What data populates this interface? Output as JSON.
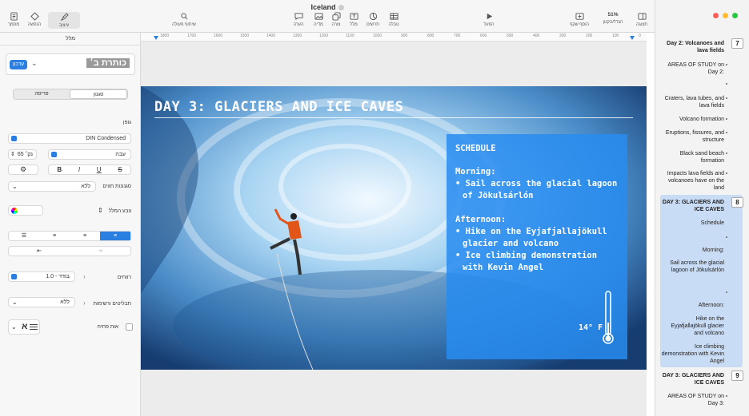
{
  "window": {
    "title": "Iceland"
  },
  "toolbar": {
    "view": "תצוגה",
    "zoom_value": "51%",
    "zoom": "הגדל/הקטן",
    "add_slide": "הוסף שקף",
    "play": "הפעל",
    "table": "טבלה",
    "chart": "תרשים",
    "text": "מלל",
    "shape": "צורה",
    "media": "מדיה",
    "comment": "הערה",
    "collaborate": "שיתוף פעולה",
    "format": "עיצוב",
    "animate": "הנפשה",
    "document": "מסמך"
  },
  "ruler": {
    "ticks": [
      "1800",
      "1700",
      "1600",
      "1500",
      "1400",
      "1300",
      "1200",
      "1100",
      "1000",
      "900",
      "800",
      "700",
      "600",
      "500",
      "400",
      "300",
      "200",
      "100",
      "0"
    ]
  },
  "inspector": {
    "header": "מלל",
    "style_name": "כותרת ב׳",
    "update_button": "עדכון",
    "tabs": [
      "פריסה",
      "סגנון"
    ],
    "font_section": "גופן",
    "font_name": "DIN Condensed",
    "font_weight": "עבה",
    "font_size": "65 נק׳",
    "char_styles_label": "סגנונות תווים",
    "char_styles_value": "ללא",
    "text_color_label": "צבע המלל",
    "spacing_label": "רווחים",
    "spacing_value": "1.0 - בודד",
    "bullets_label": "תבליטים ורשימות",
    "bullets_value": "ללא",
    "dropcap_label": "אות פתיח"
  },
  "slide": {
    "title": "DAY 3: GLACIERS AND ICE CAVES",
    "schedule": {
      "heading": "SCHEDULE",
      "morning_label": "Morning:",
      "morning_items": [
        "Sail across the glacial lagoon of Jökulsárlón"
      ],
      "afternoon_label": "Afternoon:",
      "afternoon_items": [
        "Hike on the Eyjafjallajökull glacier and volcano",
        "Ice climbing demonstration with Kevin Angel"
      ],
      "temperature": "14° F"
    }
  },
  "navigator": {
    "slide7": {
      "number": "7",
      "title": "Day 2: Volcanoes and lava fields"
    },
    "items7": [
      "AREAS OF STUDY on Day 2:",
      "Craters, lava tubes, and lava fields",
      "Volcano formation",
      "Eruptions, fissures, and structure",
      "Black sand beach formation",
      "Impacts lava fields and volcanoes have on the land"
    ],
    "slide8": {
      "number": "8",
      "title": "DAY 3: GLACIERS AND ICE CAVES"
    },
    "items8": [
      "Schedule",
      "Morning:",
      "Sail across the glacial lagoon of Jökulsárlón",
      "Afternoon:",
      "Hike on the Eyjafjallajökull glacier and volcano",
      "Ice climbing demonstration with Kevin Angel"
    ],
    "slide9": {
      "number": "9",
      "title": "DAY 3: GLACIERS AND ICE CAVES"
    },
    "items9": [
      "AREAS OF STUDY on Day 3:"
    ]
  },
  "colors": {
    "accent": "#2a7fe0",
    "schedule_box": "#288cf0",
    "selection": "#c9dcf6"
  }
}
